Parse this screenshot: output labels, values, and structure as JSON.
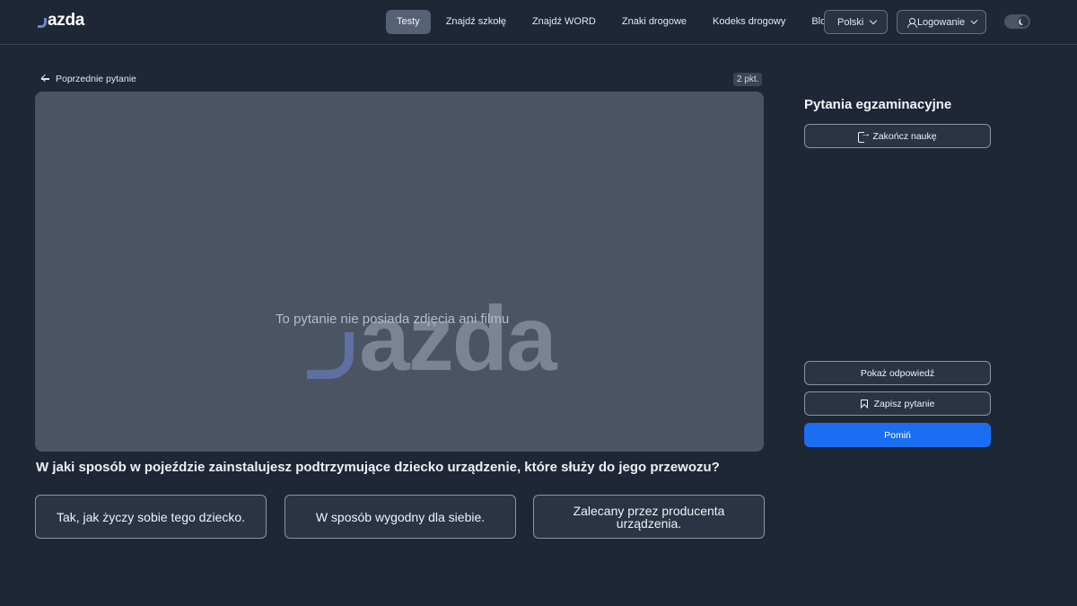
{
  "header": {
    "logo_text": "azda",
    "nav": [
      {
        "label": "Testy",
        "active": true
      },
      {
        "label": "Znajdź szkołę"
      },
      {
        "label": "Znajdź WORD"
      },
      {
        "label": "Znaki drogowe"
      },
      {
        "label": "Kodeks drogowy"
      },
      {
        "label": "Blog"
      }
    ],
    "language": "Polski",
    "login": "Logowanie",
    "theme_toggle_icon": "moon-icon"
  },
  "question_panel": {
    "back_label": "Poprzednie pytanie",
    "points": "2 pkt.",
    "media_logo_text": "azda",
    "no_media_text": "To pytanie nie posiada zdjęcia ani filmu",
    "question": "W jaki sposób w pojeździe zainstalujesz podtrzymujące dziecko urządzenie, które służy do jego przewozu?",
    "answers": [
      "Tak, jak życzy sobie tego dziecko.",
      "W sposób wygodny dla siebie.",
      "Zalecany przez producenta urządzenia."
    ]
  },
  "sidebar": {
    "title": "Pytania egzaminacyjne",
    "end_learning": "Zakończ naukę",
    "show_answer": "Pokaż odpowiedź",
    "save_question": "Zapisz pytanie",
    "skip": "Pomiń"
  },
  "colors": {
    "background": "#1f2636",
    "primary": "#1a6ef2",
    "logo_accent": "#7185c6"
  }
}
